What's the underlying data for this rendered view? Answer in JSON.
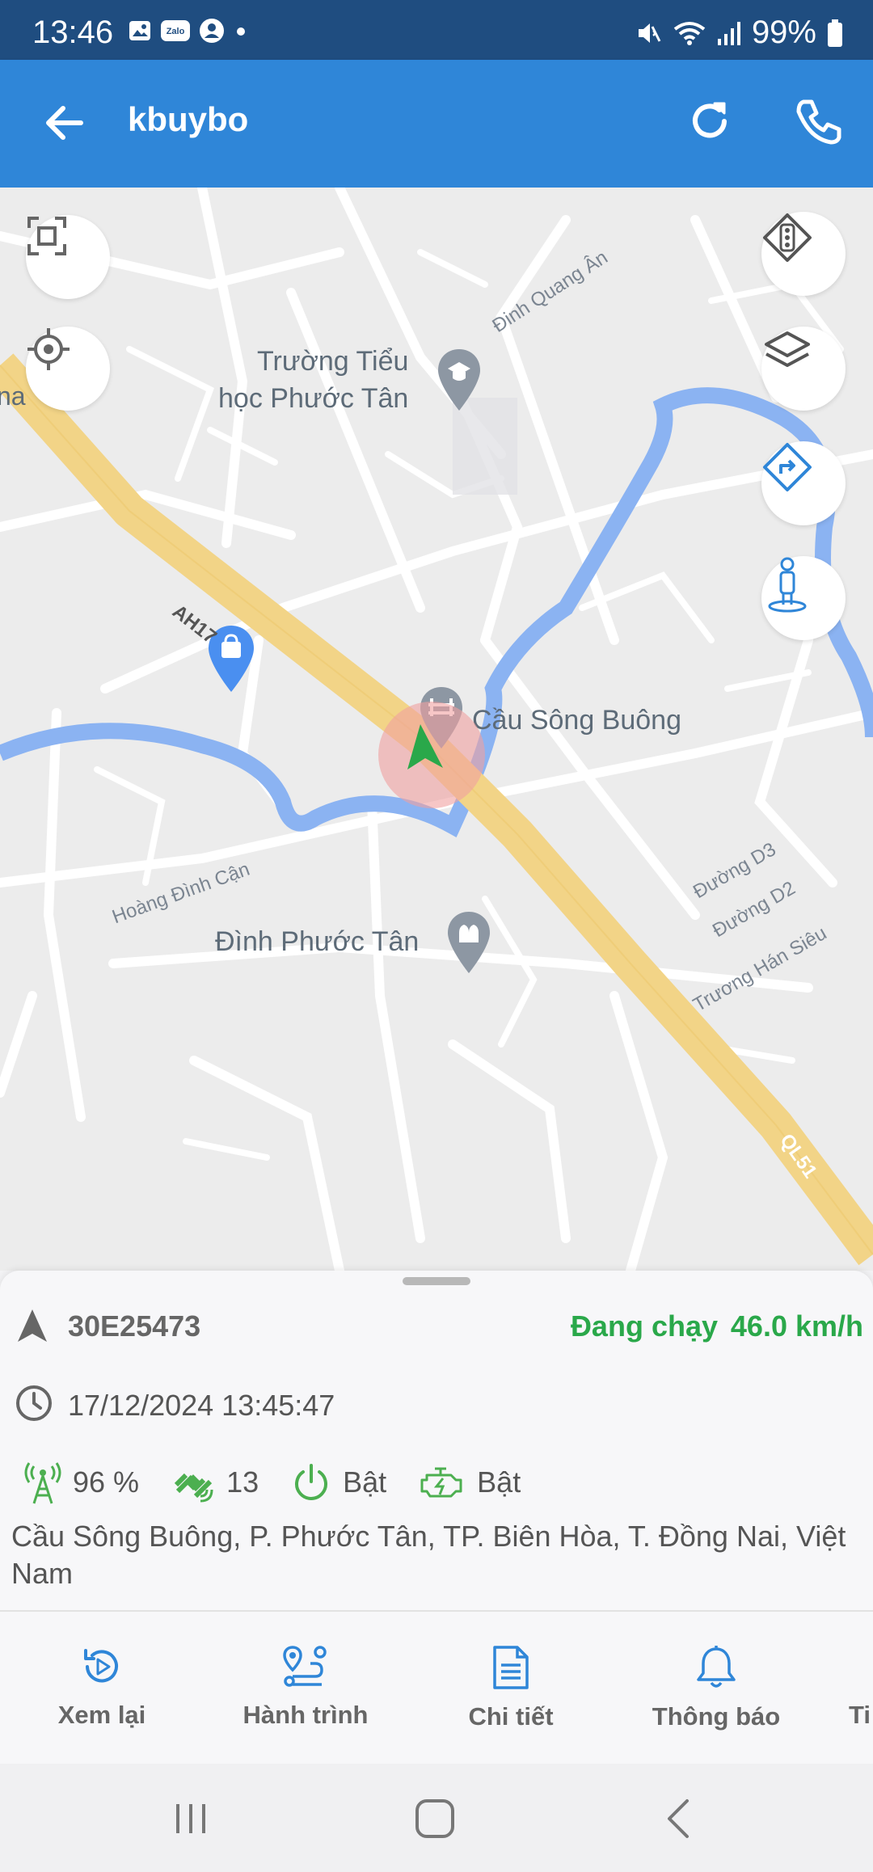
{
  "status_bar": {
    "time": "13:46",
    "battery": "99%",
    "left_icons": [
      "gallery-icon",
      "zalo-icon",
      "account-icon",
      "dot-icon"
    ],
    "right_icons": [
      "mute-icon",
      "wifi-icon",
      "signal-icon",
      "battery-icon"
    ]
  },
  "app_bar": {
    "title": "kbuybo",
    "color": "#2f86d8"
  },
  "map": {
    "places": {
      "school_line1": "Trường Tiểu",
      "school_line2": "học Phước Tân",
      "bridge": "Cầu Sông Buông",
      "temple": "Đình Phước Tân"
    },
    "streets": {
      "ah17": "AH17",
      "dinh_quang_an": "Đinh Quang Ân",
      "hoang_dinh_can": "Hoàng Đình Cận",
      "duong_d3": "Đường D3",
      "duong_d2": "Đường D2",
      "truong_han_sieu": "Trương Hán Siêu",
      "ql51": "QL51",
      "edge_fragment": "na"
    },
    "controls": [
      "fit-bounds-icon",
      "my-location-icon",
      "traffic-icon",
      "layers-icon",
      "directions-icon",
      "street-view-icon"
    ]
  },
  "vehicle": {
    "plate": "30E25473",
    "status": "Đang chạy",
    "speed": "46.0 km/h",
    "timestamp": "17/12/2024 13:45:47",
    "signal": "96 %",
    "satellites": "13",
    "power": "Bật",
    "engine": "Bật",
    "address": "Cầu Sông Buông, P. Phước Tân, TP. Biên Hòa, T. Đồng Nai, Việt Nam",
    "status_color": "#2aa84a"
  },
  "tabs": [
    {
      "label": "Xem lại",
      "icon": "replay-icon"
    },
    {
      "label": "Hành trình",
      "icon": "route-icon"
    },
    {
      "label": "Chi tiết",
      "icon": "document-icon"
    },
    {
      "label": "Thông báo",
      "icon": "bell-icon"
    },
    {
      "label": "Ti",
      "icon": "more-tab-icon"
    }
  ],
  "nav": [
    "recents-button",
    "home-button",
    "back-button"
  ]
}
